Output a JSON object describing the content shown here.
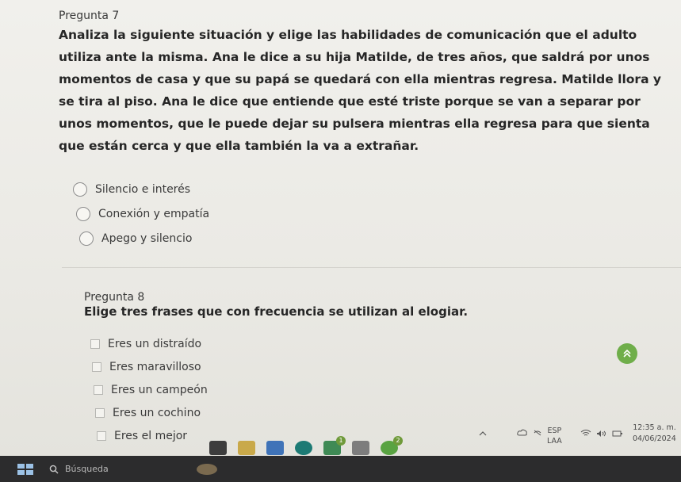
{
  "question7": {
    "label": "Pregunta 7",
    "text": "Analiza la siguiente situación y elige las habilidades de comunicación que el adulto utiliza ante la misma. Ana le dice a su hija Matilde, de tres años, que saldrá por unos momentos de casa y que su papá se quedará con ella mientras regresa. Matilde llora y se tira al piso. Ana le dice que entiende que esté triste porque se van a separar por unos momentos, que le puede dejar su pulsera mientras ella regresa para que sienta que están cerca y que ella también la va a extrañar.",
    "options": [
      "Silencio e interés",
      "Conexión y empatía",
      "Apego y silencio"
    ]
  },
  "question8": {
    "label": "Pregunta 8",
    "text": "Elige tres frases que con frecuencia se utilizan al elogiar.",
    "options": [
      "Eres un distraído",
      "Eres maravilloso",
      "Eres un campeón",
      "Eres un cochino",
      "Eres el mejor"
    ]
  },
  "system_tray": {
    "language": "ESP",
    "layout": "LAA",
    "time": "12:35 a. m.",
    "date": "04/06/2024"
  },
  "taskbar": {
    "search_placeholder": "Búsqueda",
    "badges": [
      "1",
      "2"
    ]
  },
  "icons": {
    "scroll_top": "double-chevron-up-icon",
    "search": "search-icon",
    "wifi": "wifi-icon",
    "volume": "speaker-icon",
    "battery": "battery-icon"
  },
  "colors": {
    "scroll_top": "#6fae4a",
    "taskbar": "#2c2c2d"
  }
}
